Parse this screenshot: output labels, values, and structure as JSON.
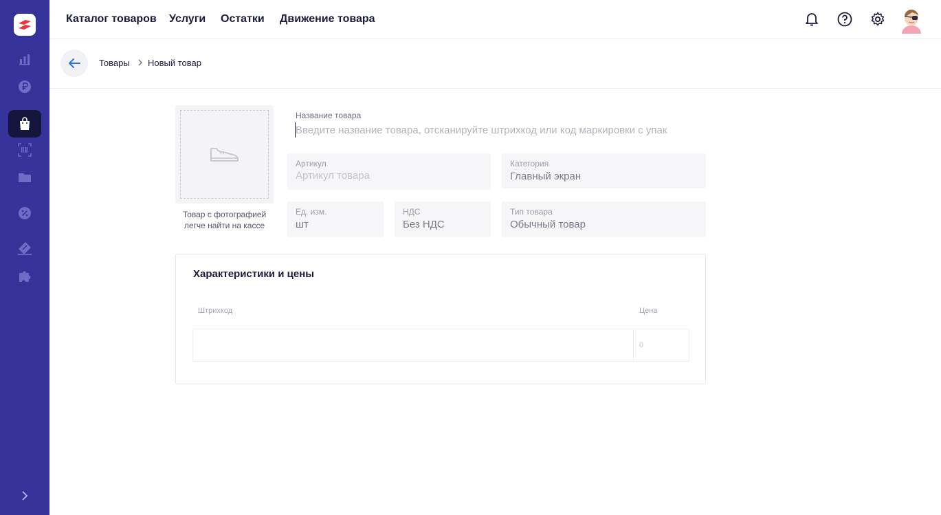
{
  "topnav": {
    "items": [
      "Каталог товаров",
      "Услуги",
      "Остатки",
      "Движение товара"
    ]
  },
  "breadcrumb": {
    "parent": "Товары",
    "current": "Новый товар"
  },
  "photo": {
    "hint": "Товар с фотографией легче найти на кассе"
  },
  "form": {
    "name": {
      "label": "Название товара",
      "placeholder": "Введите название товара, отсканируйте штрихкод или код маркировки с упак"
    },
    "article": {
      "label": "Артикул",
      "placeholder": "Артикул товара"
    },
    "category": {
      "label": "Категория",
      "value": "Главный экран"
    },
    "unit": {
      "label": "Ед. изм.",
      "value": "шт"
    },
    "vat": {
      "label": "НДС",
      "value": "Без НДС"
    },
    "product_type": {
      "label": "Тип товара",
      "value": "Обычный товар"
    }
  },
  "characteristics": {
    "title": "Характеристики и цены",
    "columns": {
      "barcode": "Штрихкод",
      "price": "Цена"
    },
    "price_placeholder": "0"
  },
  "icons": {
    "sidebar": [
      "chart-icon",
      "ruble-icon",
      "shopping-bag-icon",
      "barcode-scan-icon",
      "folder-icon",
      "discount-icon",
      "ticket-icon",
      "puzzle-icon"
    ],
    "top": [
      "bell-icon",
      "help-icon",
      "gear-icon"
    ]
  },
  "colors": {
    "sidebar": "#35339a",
    "sidebar_active": "#15153d",
    "brand": "#e8343a",
    "accent": "#2d6fe8"
  }
}
